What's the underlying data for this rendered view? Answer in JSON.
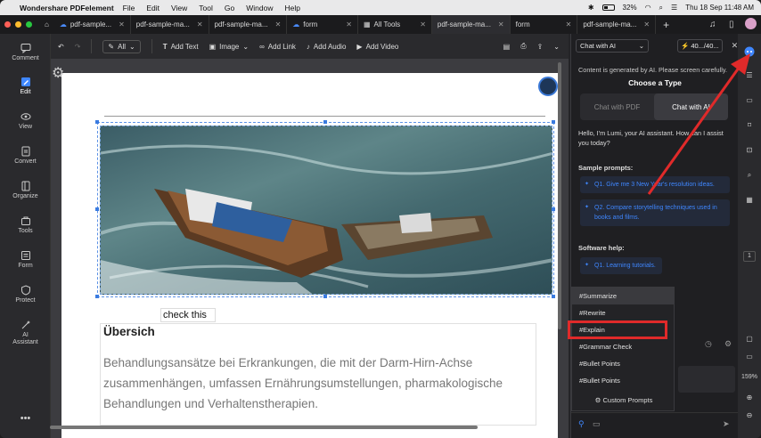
{
  "menubar": {
    "app_name": "Wondershare PDFelement",
    "items": [
      "File",
      "Edit",
      "View",
      "Tool",
      "Go",
      "Window",
      "Help"
    ],
    "battery": "32%",
    "clock": "Thu 18 Sep 11:48 AM"
  },
  "tabs": [
    {
      "label": "pdf-sample...",
      "cloud": true
    },
    {
      "label": "pdf-sample-ma...",
      "cloud": false
    },
    {
      "label": "pdf-sample-ma...",
      "cloud": false
    },
    {
      "label": "form",
      "cloud": true
    },
    {
      "label": "All Tools",
      "cloud": false
    },
    {
      "label": "pdf-sample-ma...",
      "cloud": false,
      "active": true
    },
    {
      "label": "form",
      "cloud": false
    },
    {
      "label": "pdf-sample-ma...",
      "cloud": false
    }
  ],
  "sidebar": {
    "items": [
      {
        "label": "Comment",
        "icon": "comment-icon"
      },
      {
        "label": "Edit",
        "icon": "edit-icon"
      },
      {
        "label": "View",
        "icon": "eye-icon"
      },
      {
        "label": "Convert",
        "icon": "convert-icon"
      },
      {
        "label": "Organize",
        "icon": "organize-icon"
      },
      {
        "label": "Tools",
        "icon": "toolbox-icon"
      },
      {
        "label": "Form",
        "icon": "form-icon"
      },
      {
        "label": "Protect",
        "icon": "shield-icon"
      },
      {
        "label": "AI Assistant",
        "icon": "ai-icon"
      }
    ],
    "more": "•••"
  },
  "toolbar": {
    "all_label": "All",
    "add_text": "Add Text",
    "image": "Image",
    "add_link": "Add Link",
    "add_audio": "Add Audio",
    "add_video": "Add Video"
  },
  "document": {
    "check_this": "check this",
    "heading": "Übersich",
    "paragraph": "Behandlungsansätze bei Erkrankungen, die mit der Darm-Hirn-Achse zusammenhängen, umfassen Ernährungsumstellungen, pharmakologische Behandlungen und Verhaltenstherapien."
  },
  "ai_panel": {
    "mode_select": "Chat with AI",
    "credits": "40.../40...",
    "notice": "Content is generated by AI. Please screen carefully.",
    "choose_type": "Choose a Type",
    "type_pdf": "Chat with PDF",
    "type_ai": "Chat with AI",
    "greeting": "Hello, I'm Lumi, your AI assistant. How can I assist you today?",
    "sample_label": "Sample prompts:",
    "prompts": [
      "Q1. Give me 3 New Year's resolution ideas.",
      "Q2. Compare storytelling techniques used in books and films."
    ],
    "help_label": "Software help:",
    "help_items": [
      "Q1. Learning tutorials."
    ]
  },
  "menu": {
    "items": [
      "#Summarize",
      "#Rewrite",
      "#Explain",
      "#Grammar Check",
      "#Bullet Points",
      "#Bullet Points"
    ],
    "custom": "Custom Prompts",
    "highlighted": "#Explain"
  },
  "rail": {
    "page": "1",
    "zoom": "159%"
  },
  "colors": {
    "accent": "#3f87ff",
    "highlight": "#e02a2a",
    "arrow": "#e02a2a"
  }
}
